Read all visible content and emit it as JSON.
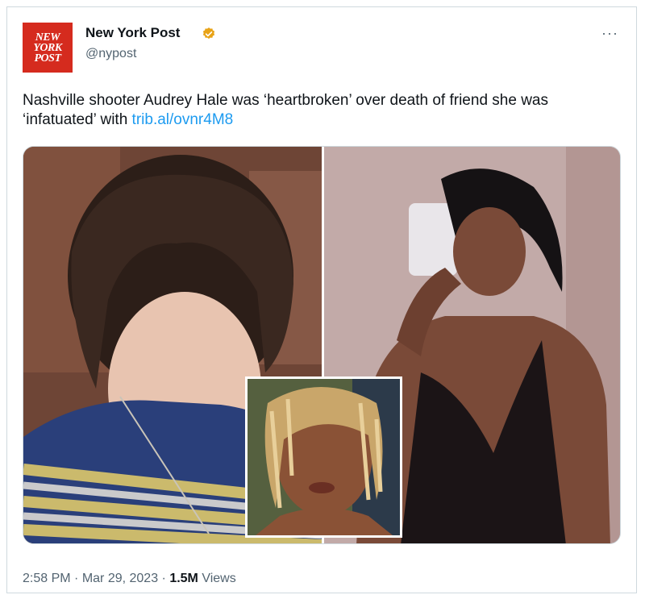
{
  "author": {
    "avatar_text": [
      "NEW",
      "YORK",
      "POST"
    ],
    "name": "New York Post",
    "handle": "@nypost",
    "verified_icon": "verified-badge-icon",
    "verified_color": "#e8a317"
  },
  "more_label": "···",
  "tweet": {
    "text": "Nashville shooter Audrey Hale was ‘heartbroken’ over death of friend she was ‘infatuated’ with ",
    "link": "trib.al/ovnr4M8",
    "link_color": "#1d9bf0"
  },
  "media": {
    "left_photo": "portrait-photo",
    "right_photo": "mirror-selfie-photo",
    "inset_photo": "inset-portrait-photo"
  },
  "meta": {
    "time": "2:58 PM",
    "separator": " · ",
    "date": "Mar 29, 2023",
    "views_count": "1.5M",
    "views_label": " Views"
  },
  "colors": {
    "brand_red": "#d52b1e",
    "border": "#cfd9de",
    "secondary_text": "#536471"
  }
}
